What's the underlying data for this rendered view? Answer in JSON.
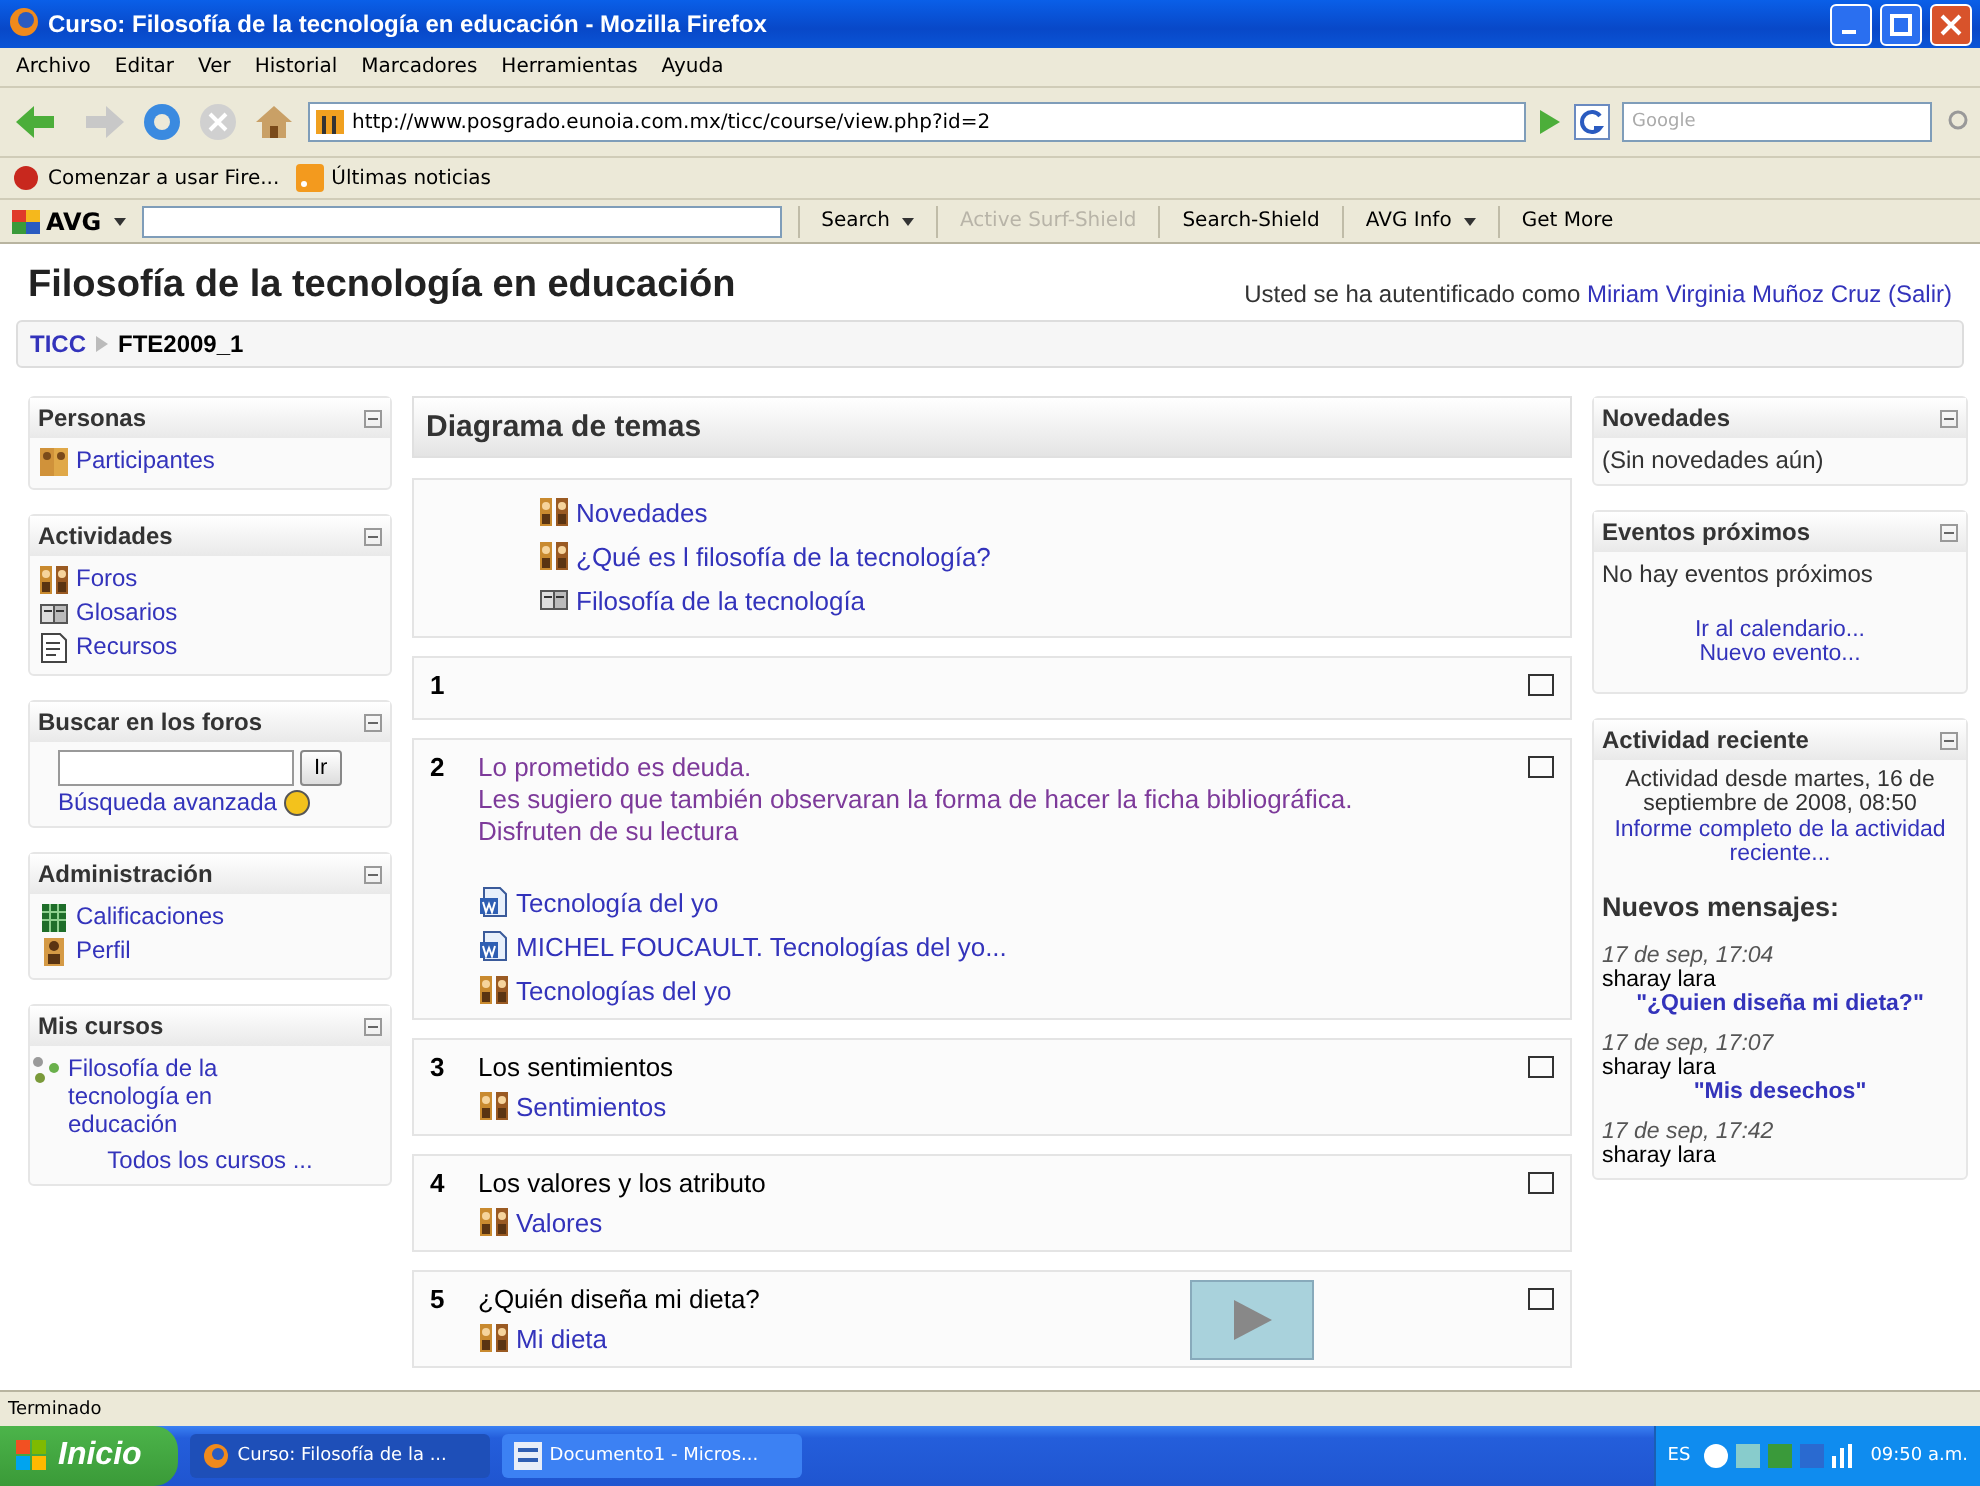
{
  "window": {
    "title": "Curso: Filosofía de la tecnología en educación - Mozilla Firefox"
  },
  "menu": [
    "Archivo",
    "Editar",
    "Ver",
    "Historial",
    "Marcadores",
    "Herramientas",
    "Ayuda"
  ],
  "navigation": {
    "url": "http://www.posgrado.eunoia.com.mx/ticc/course/view.php?id=2",
    "search_placeholder": "Google"
  },
  "bookmarks": [
    "Comenzar a usar Fire...",
    "Últimas noticias"
  ],
  "avg_toolbar": {
    "logo": "AVG",
    "items": [
      {
        "label": "Search",
        "disabled": false,
        "menu": true
      },
      {
        "label": "Active Surf-Shield",
        "disabled": true,
        "menu": false
      },
      {
        "label": "Search-Shield",
        "disabled": false,
        "menu": false
      },
      {
        "label": "AVG Info",
        "disabled": false,
        "menu": true
      },
      {
        "label": "Get More",
        "disabled": false,
        "menu": false
      }
    ]
  },
  "page": {
    "course_title": "Filosofía de la tecnología en educación",
    "login_text": "Usted se ha autentificado como",
    "user": "Miriam Virginia Muñoz Cruz",
    "logout": "(Salir)",
    "breadcrumb": [
      "TICC",
      "FTE2009_1"
    ]
  },
  "left_blocks": [
    {
      "title": "Personas",
      "kind": "links",
      "items": [
        {
          "label": "Participantes",
          "kind": "people"
        }
      ]
    },
    {
      "title": "Actividades",
      "kind": "links",
      "items": [
        {
          "label": "Foros",
          "kind": "forum"
        },
        {
          "label": "Glosarios",
          "kind": "glossary"
        },
        {
          "label": "Recursos",
          "kind": "resource"
        }
      ]
    },
    {
      "title": "Buscar en los foros",
      "kind": "search",
      "button": "Ir",
      "link": "Búsqueda avanzada"
    },
    {
      "title": "Administración",
      "kind": "links",
      "items": [
        {
          "label": "Calificaciones",
          "kind": "grades"
        },
        {
          "label": "Perfil",
          "kind": "profile"
        }
      ]
    },
    {
      "title": "Mis cursos",
      "kind": "courses",
      "items": [
        {
          "label": "Filosofía de la tecnología en educación",
          "kind": "course"
        }
      ],
      "footer": "Todos los cursos ..."
    }
  ],
  "topics": {
    "title": "Diagrama de temas",
    "sections": [
      {
        "activities": [
          {
            "label": "Novedades",
            "kind": "forum"
          },
          {
            "label": "¿Qué es l filosofía de la tecnología?",
            "kind": "forum"
          },
          {
            "label": "Filosofía de la tecnología",
            "kind": "glossary"
          }
        ]
      },
      {
        "number": "1",
        "highlighted": false
      },
      {
        "number": "2",
        "highlighted": false,
        "color": "#7d3a9a",
        "summary": [
          "Lo prometido es deuda.",
          "Les sugiero que también observaran la forma de hacer la ficha bibliográfica.",
          "Disfruten de su lectura"
        ],
        "activities": [
          {
            "label": "Tecnología del yo",
            "kind": "doc"
          },
          {
            "label": "MICHEL FOUCAULT. Tecnologías del yo...",
            "kind": "doc"
          },
          {
            "label": "Tecnologías del yo",
            "kind": "forum"
          }
        ]
      },
      {
        "number": "3",
        "highlighted": false,
        "summary": [
          "Los sentimientos"
        ],
        "activities": [
          {
            "label": "Sentimientos",
            "kind": "forum"
          }
        ]
      },
      {
        "number": "4",
        "highlighted": false,
        "summary": [
          "Los valores y los atributo"
        ],
        "activities": [
          {
            "label": "Valores",
            "kind": "forum"
          }
        ]
      },
      {
        "number": "5",
        "highlighted": false,
        "summary": [
          "¿Quién diseña mi dieta?"
        ],
        "activities": [
          {
            "label": "Mi dieta",
            "kind": "forum"
          }
        ],
        "player": true
      }
    ]
  },
  "right_blocks": [
    {
      "title": "Novedades",
      "kind": "text",
      "text": "(Sin novedades aún)"
    },
    {
      "title": "Eventos próximos",
      "kind": "events",
      "text": "No hay eventos próximos",
      "links": [
        "Ir al calendario...",
        "Nuevo evento..."
      ]
    },
    {
      "title": "Actividad reciente",
      "kind": "recent",
      "text": "Actividad desde martes, 16 de septiembre de 2008, 08:50",
      "link": "Informe completo de la actividad reciente...",
      "heading": "Nuevos mensajes:",
      "posts": [
        {
          "date": "17 de sep, 17:04",
          "author": "sharay lara",
          "subject": "\"¿Quien diseña mi dieta?\""
        },
        {
          "date": "17 de sep, 17:07",
          "author": "sharay lara",
          "subject": "\"Mis desechos\""
        },
        {
          "date": "17 de sep, 17:42",
          "author": "sharay lara"
        }
      ]
    }
  ],
  "status_bar": "Terminado",
  "taskbar": {
    "start": "Inicio",
    "tasks": [
      {
        "label": "Curso: Filosofía de la ...",
        "kind": "firefox",
        "selected": true
      },
      {
        "label": "Documento1 - Micros...",
        "kind": "word",
        "selected": false
      }
    ],
    "language": "ES",
    "clock": "09:50 a.m."
  }
}
